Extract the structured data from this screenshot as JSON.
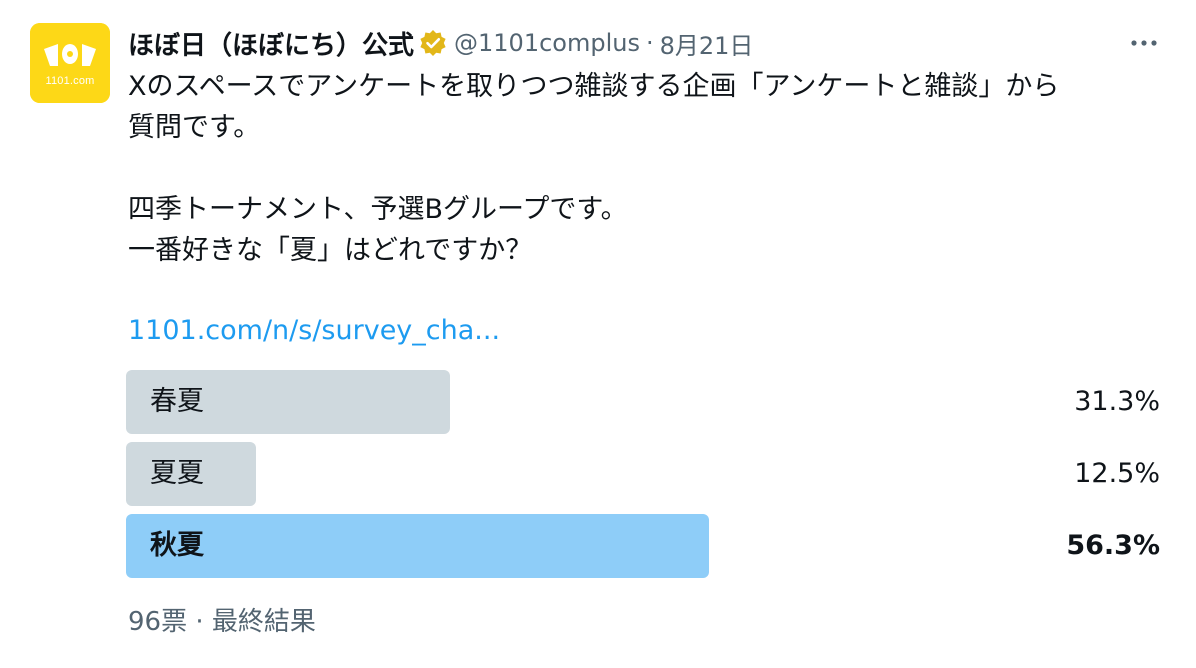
{
  "account": {
    "display_name": "ほぼ日（ほぼにち）公式",
    "handle": "@1101complus",
    "separator": "·",
    "date": "8月21日",
    "avatar_text": "1101.com",
    "verified_color": "#e2b719"
  },
  "tweet": {
    "lines": [
      "Xのスペースでアンケートを取りつつ雑談する企画「アンケートと雑談」から",
      "質問です。",
      "",
      "四季トーナメント、予選Bグループです。",
      "一番好きな「夏」はどれですか？"
    ],
    "link_text": "1101.com/n/s/survey_cha..."
  },
  "poll": {
    "options": [
      {
        "label": "春夏",
        "percent_text": "31.3%",
        "percent": 31.3,
        "winner": false
      },
      {
        "label": "夏夏",
        "percent_text": "12.5%",
        "percent": 12.5,
        "winner": false
      },
      {
        "label": "秋夏",
        "percent_text": "56.3%",
        "percent": 56.3,
        "winner": true
      }
    ],
    "votes": "96票",
    "separator": "·",
    "status": "最終結果"
  },
  "colors": {
    "bar_default": "#cfd9de",
    "bar_winner": "#8ecdf8",
    "link": "#1d9bf0",
    "secondary_text": "#536471",
    "avatar_bg": "#fdd817"
  },
  "icons": {
    "more": "more-horizontal-icon",
    "verified": "verified-badge-icon"
  }
}
